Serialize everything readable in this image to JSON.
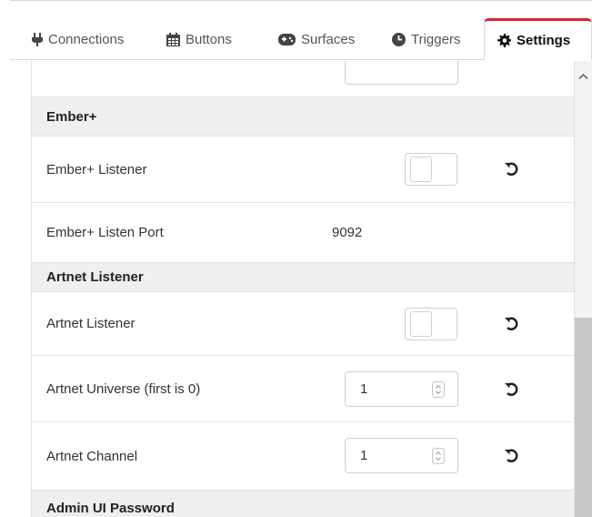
{
  "tabs": [
    {
      "label": "Connections",
      "icon": "plug-icon"
    },
    {
      "label": "Buttons",
      "icon": "calendar-grid-icon"
    },
    {
      "label": "Surfaces",
      "icon": "gamepad-icon"
    },
    {
      "label": "Triggers",
      "icon": "clock-icon"
    },
    {
      "label": "Settings",
      "icon": "gear-icon",
      "active": true
    }
  ],
  "settings": {
    "ember_header": "Ember+",
    "ember_listener": {
      "label": "Ember+ Listener",
      "enabled": false
    },
    "ember_port": {
      "label": "Ember+ Listen Port",
      "value": "9092"
    },
    "artnet_header": "Artnet Listener",
    "artnet_listener": {
      "label": "Artnet Listener",
      "enabled": false
    },
    "artnet_universe": {
      "label": "Artnet Universe (first is 0)",
      "value": "1"
    },
    "artnet_channel": {
      "label": "Artnet Channel",
      "value": "1"
    },
    "admin_header": "Admin UI Password"
  },
  "colors": {
    "accent": "#d9232d",
    "header_bg": "#efefef",
    "scroll_thumb": "#c8c8c8"
  }
}
